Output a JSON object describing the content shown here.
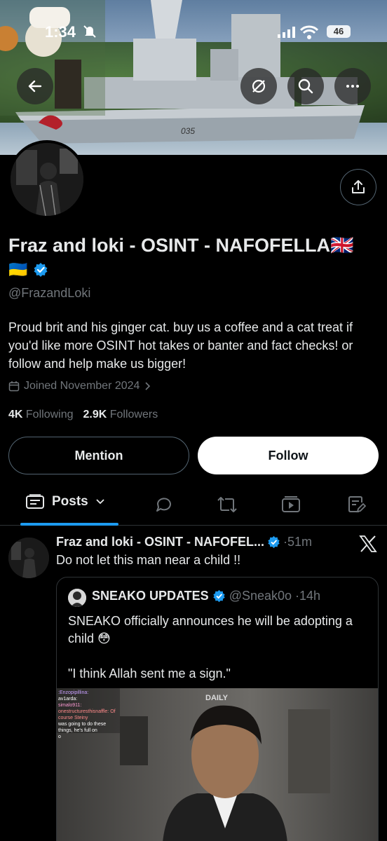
{
  "status_bar": {
    "time": "1:34",
    "battery": "46"
  },
  "banner": {
    "hull_number": "035"
  },
  "profile": {
    "display_name": "Fraz and loki - OSINT - NAFOFELLA🇬🇧",
    "flag_emoji": "🇺🇦",
    "handle": "@FrazandLoki",
    "bio": "Proud brit and his ginger cat. buy us a coffee and a cat treat if you'd like more OSINT hot takes or banter and fact checks! or follow and help make us bigger!",
    "joined": "Joined November 2024",
    "following_count": "4K",
    "following_label": "Following",
    "followers_count": "2.9K",
    "followers_label": "Followers",
    "verified_color": "#1d9bf0"
  },
  "actions": {
    "mention_label": "Mention",
    "follow_label": "Follow"
  },
  "tabs": {
    "posts_label": "Posts"
  },
  "post": {
    "author_name": "Fraz and loki - OSINT - NAFOFEL...",
    "time": "·51m",
    "text": "Do not let this man near a child !!",
    "quote": {
      "author_name": "SNEAKO UPDATES",
      "author_handle": "@Sneak0o",
      "time": "·14h",
      "text_line1": "SNEAKO officially announces he will be adopting a child 😳",
      "text_line2": "\"I think Allah sent me a sign.\"",
      "media_daily": "DAILY",
      "chat_lines": [
        ":Enzopipillina:",
        "av1arda:",
        "simalo911:",
        "onestructuresthisnaffle: Of course Steiny",
        "was going to do these things, he's full on",
        "o"
      ]
    }
  },
  "colors": {
    "accent": "#1d9bf0",
    "muted": "#71767b",
    "border": "#2f3336"
  }
}
